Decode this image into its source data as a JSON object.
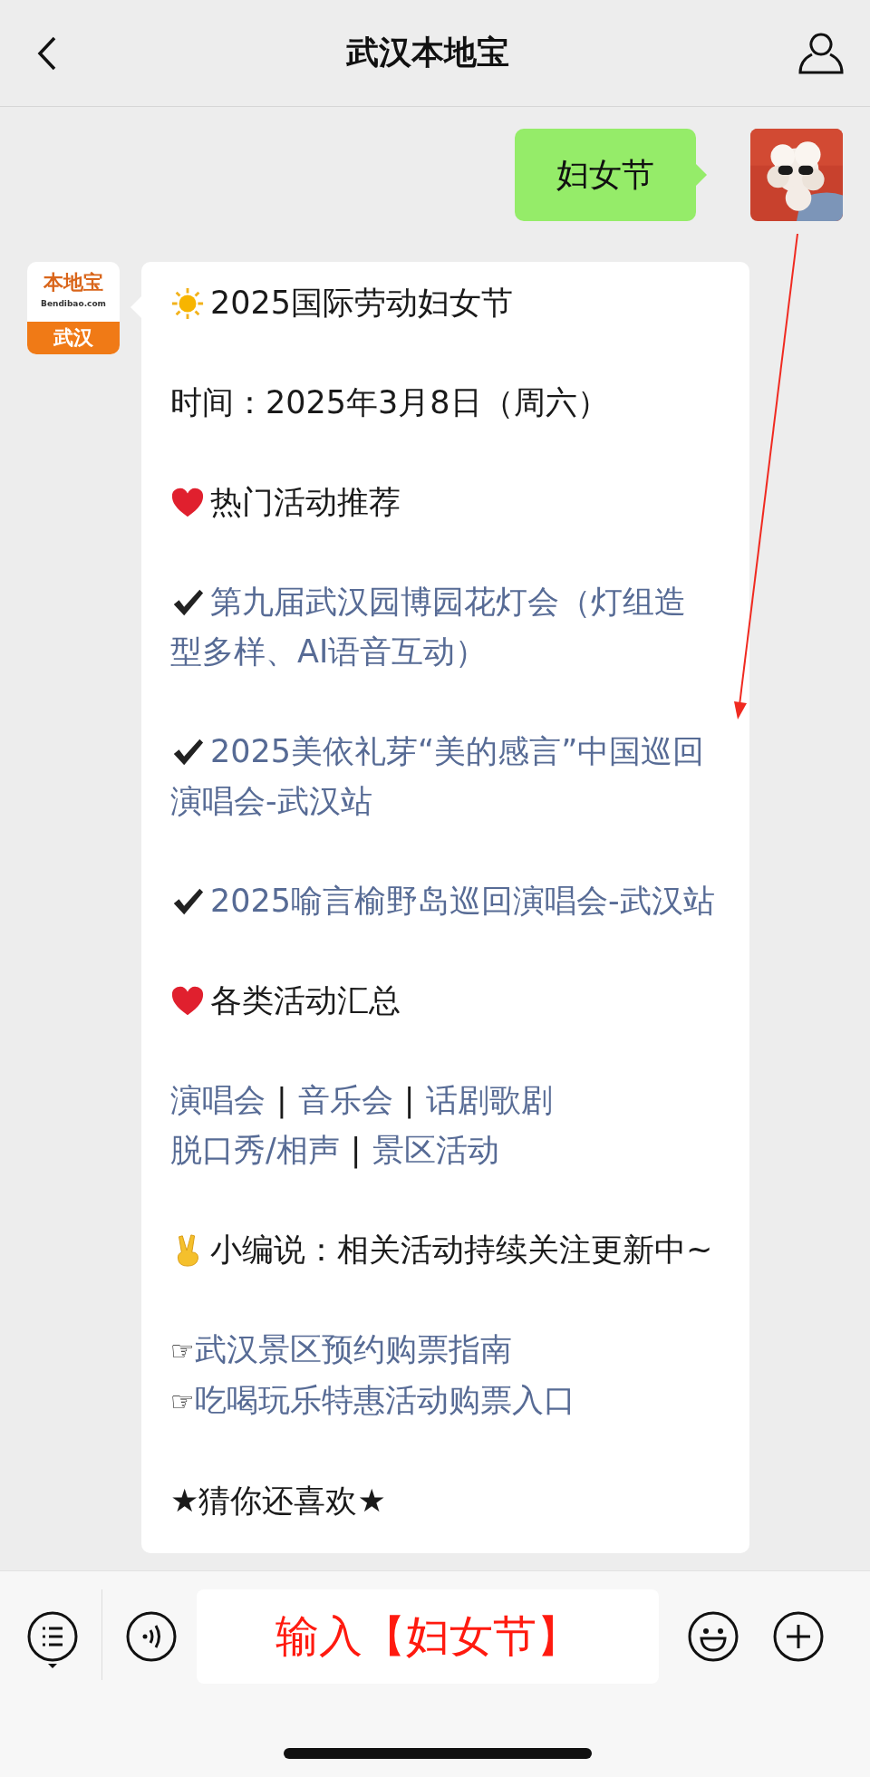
{
  "header": {
    "title": "武汉本地宝"
  },
  "sent": {
    "text": "妇女节"
  },
  "account_logo": {
    "top": "本地宝",
    "domain": "Bendibao.com",
    "city": "武汉"
  },
  "blocks": [
    {
      "kind": "sun",
      "lines": [
        [
          {
            "kind": "text",
            "text": "2025国际劳动妇女节"
          }
        ]
      ]
    },
    {
      "kind": "plain",
      "lines": [
        [
          {
            "kind": "text",
            "text": "时间：2025年3月8日（周六）"
          }
        ]
      ]
    },
    {
      "kind": "heart",
      "lines": [
        [
          {
            "kind": "text",
            "text": "热门活动推荐"
          }
        ]
      ]
    },
    {
      "kind": "check",
      "lines": [
        [
          {
            "kind": "link",
            "text": "第九届武汉园博园花灯会（灯组造型多样、AI语音互动）"
          }
        ]
      ]
    },
    {
      "kind": "check",
      "lines": [
        [
          {
            "kind": "link",
            "text": "2025美依礼芽“美的感言”中国巡回演唱会-武汉站"
          }
        ]
      ]
    },
    {
      "kind": "check",
      "lines": [
        [
          {
            "kind": "link",
            "text": "2025喻言榆野岛巡回演唱会-武汉站"
          }
        ]
      ]
    },
    {
      "kind": "heart",
      "lines": [
        [
          {
            "kind": "text",
            "text": "各类活动汇总"
          }
        ]
      ]
    },
    {
      "kind": "plain",
      "lines": [
        [
          {
            "kind": "link",
            "text": "演唱会"
          },
          {
            "kind": "sep",
            "text": "|"
          },
          {
            "kind": "link",
            "text": "音乐会"
          },
          {
            "kind": "sep",
            "text": "|"
          },
          {
            "kind": "link",
            "text": "话剧歌剧"
          }
        ],
        [
          {
            "kind": "link",
            "text": "脱口秀/相声"
          },
          {
            "kind": "sep",
            "text": "|"
          },
          {
            "kind": "link",
            "text": "景区活动"
          }
        ]
      ]
    },
    {
      "kind": "victory",
      "lines": [
        [
          {
            "kind": "text",
            "text": "小编说：相关活动持续关注更新中~"
          }
        ]
      ]
    },
    {
      "kind": "plain",
      "lines": [
        [
          {
            "kind": "glyph",
            "text": "☞"
          },
          {
            "kind": "link",
            "text": "武汉景区预约购票指南"
          }
        ],
        [
          {
            "kind": "glyph",
            "text": "☞"
          },
          {
            "kind": "link",
            "text": "吃喝玩乐特惠活动购票入口"
          }
        ]
      ]
    },
    {
      "kind": "plain",
      "lines": [
        [
          {
            "kind": "text",
            "text": "★猜你还喜欢★"
          }
        ]
      ]
    }
  ],
  "input": {
    "text": "输入【妇女节】"
  }
}
